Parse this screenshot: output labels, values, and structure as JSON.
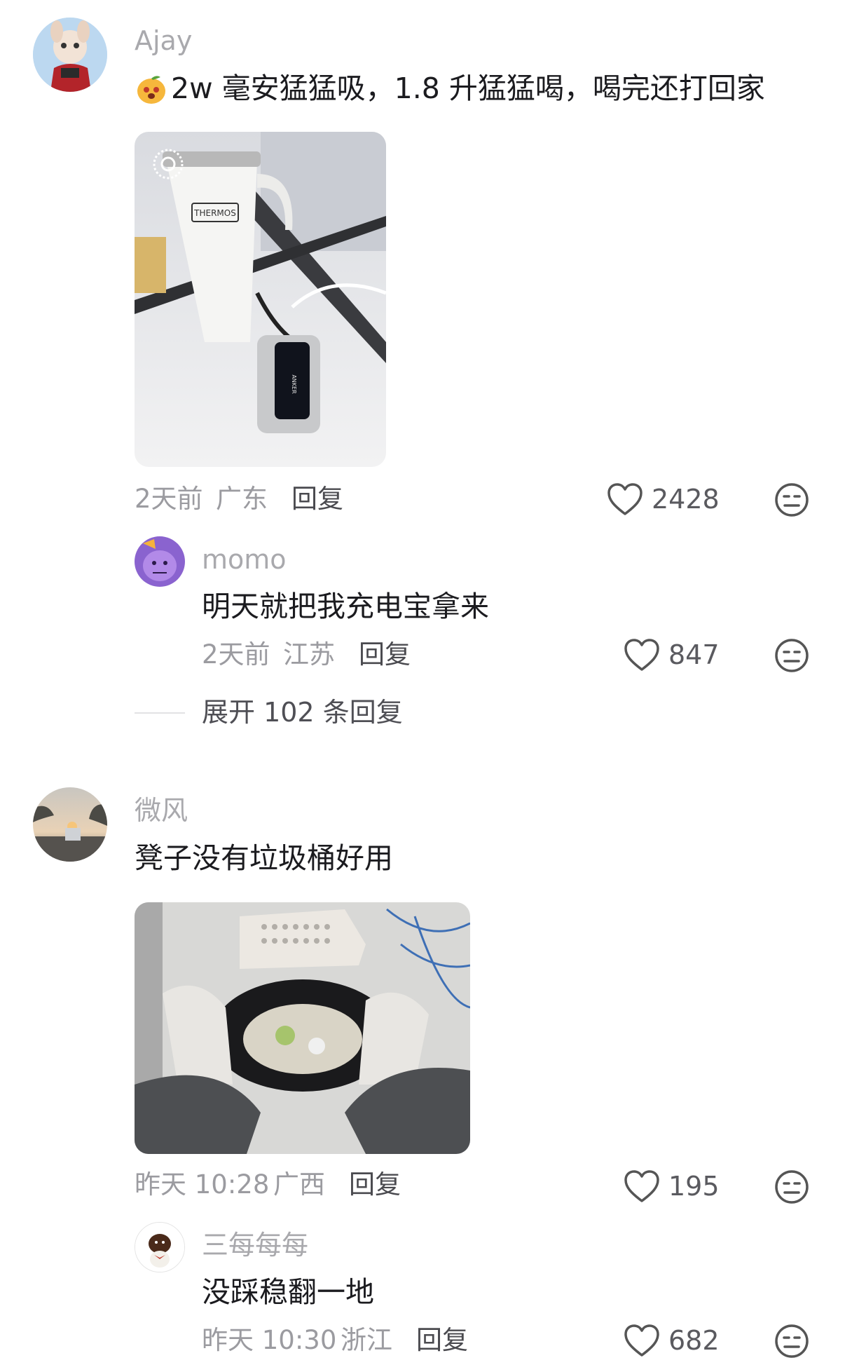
{
  "comments": [
    {
      "user": "Ajay",
      "emoji": "mango-emoji",
      "text": "2w 毫安猛猛吸，1.8 升猛猛喝，喝完还打回家",
      "time": "2天前",
      "location": "广东",
      "reply_label": "回复",
      "likes": "2428",
      "image": "thermos-and-power-bank-photo",
      "replies": [
        {
          "user": "momo",
          "text": "明天就把我充电宝拿来",
          "time": "2天前",
          "location": "江苏",
          "reply_label": "回复",
          "likes": "847"
        }
      ],
      "expand_label": "展开 102 条回复"
    },
    {
      "user": "微风",
      "text": "凳子没有垃圾桶好用",
      "time": "昨天 10:28",
      "location": "广西",
      "reply_label": "回复",
      "likes": "195",
      "image": "feet-on-trash-bin-photo",
      "replies": [
        {
          "user": "三每每每",
          "text": "没踩稳翻一地",
          "time": "昨天 10:30",
          "location": "浙江",
          "reply_label": "回复",
          "likes": "682"
        }
      ]
    }
  ],
  "icons": {
    "like": "heart-outline-icon",
    "dislike": "meh-face-icon"
  },
  "colors": {
    "username": "#a9a9ad",
    "text": "#1b1b1f",
    "meta": "#9b9ba0",
    "icon": "#555555"
  }
}
